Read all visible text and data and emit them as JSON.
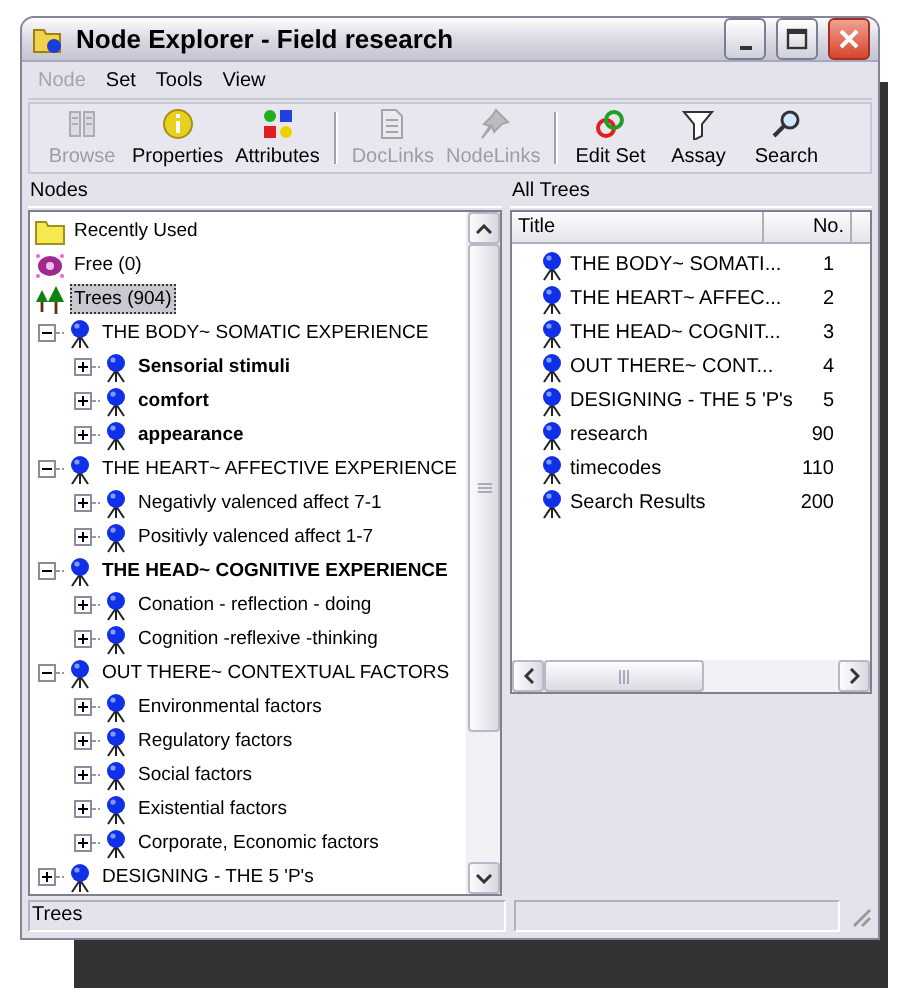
{
  "window": {
    "title": "Node Explorer - Field research"
  },
  "menu": [
    {
      "label": "Node",
      "disabled": true
    },
    {
      "label": "Set",
      "disabled": false
    },
    {
      "label": "Tools",
      "disabled": false
    },
    {
      "label": "View",
      "disabled": false
    }
  ],
  "toolbar": [
    [
      {
        "label": "Browse",
        "disabled": true
      },
      {
        "label": "Properties",
        "disabled": false
      },
      {
        "label": "Attributes",
        "disabled": false
      }
    ],
    [
      {
        "label": "DocLinks",
        "disabled": true
      },
      {
        "label": "NodeLinks",
        "disabled": true
      }
    ],
    [
      {
        "label": "Edit Set",
        "disabled": false
      },
      {
        "label": "Assay",
        "disabled": false
      },
      {
        "label": "Search",
        "disabled": false
      }
    ]
  ],
  "nodes_pane": {
    "title": "Nodes",
    "items": [
      {
        "kind": "folder",
        "label": "Recently Used",
        "selected": false
      },
      {
        "kind": "pool",
        "label": "Free (0)",
        "selected": false
      },
      {
        "kind": "trees",
        "label": "Trees (904)",
        "selected": true,
        "children": [
          {
            "label": "THE BODY~ SOMATIC EXPERIENCE",
            "bold": false,
            "expanded": true,
            "selected": false,
            "children": [
              {
                "label": "Sensorial stimuli",
                "bold": true,
                "expanded": false,
                "selected": false
              },
              {
                "label": "comfort",
                "bold": true,
                "expanded": false,
                "selected": false
              },
              {
                "label": "appearance",
                "bold": true,
                "expanded": false,
                "selected": false
              }
            ]
          },
          {
            "label": "THE HEART~ AFFECTIVE EXPERIENCE",
            "bold": false,
            "expanded": true,
            "selected": false,
            "children": [
              {
                "label": "Negativly valenced affect 7-1",
                "bold": false,
                "expanded": false,
                "selected": false
              },
              {
                "label": "Positivly valenced affect 1-7",
                "bold": false,
                "expanded": false,
                "selected": false
              }
            ]
          },
          {
            "label": "THE HEAD~ COGNITIVE EXPERIENCE",
            "bold": true,
            "expanded": true,
            "selected": false,
            "children": [
              {
                "label": "Conation - reflection - doing",
                "bold": false,
                "expanded": false,
                "selected": false
              },
              {
                "label": "Cognition -reflexive -thinking",
                "bold": false,
                "expanded": false,
                "selected": false
              }
            ]
          },
          {
            "label": "OUT THERE~ CONTEXTUAL FACTORS",
            "bold": false,
            "expanded": true,
            "selected": false,
            "children": [
              {
                "label": "Environmental factors",
                "bold": false,
                "expanded": false,
                "selected": false
              },
              {
                "label": "Regulatory factors",
                "bold": false,
                "expanded": false,
                "selected": false
              },
              {
                "label": "Social factors",
                "bold": false,
                "expanded": false,
                "selected": false
              },
              {
                "label": "Existential factors",
                "bold": false,
                "expanded": false,
                "selected": false
              },
              {
                "label": "Corporate, Economic factors",
                "bold": false,
                "expanded": false,
                "selected": false
              }
            ]
          },
          {
            "label": "DESIGNING - THE 5 'P's",
            "bold": false,
            "expanded": false,
            "selected": false
          }
        ]
      }
    ]
  },
  "trees_pane": {
    "title": "All Trees",
    "columns": [
      "Title",
      "No."
    ],
    "rows": [
      {
        "title": "THE BODY~ SOMATI...",
        "number": "1"
      },
      {
        "title": "THE HEART~ AFFEC...",
        "number": "2"
      },
      {
        "title": "THE HEAD~ COGNIT...",
        "number": "3"
      },
      {
        "title": "OUT THERE~ CONT...",
        "number": "4"
      },
      {
        "title": "DESIGNING - THE 5 'P's",
        "number": "5"
      },
      {
        "title": "research",
        "number": "90"
      },
      {
        "title": "timecodes",
        "number": "110"
      },
      {
        "title": "Search Results",
        "number": "200"
      }
    ]
  },
  "status_bar": {
    "text": "Trees"
  }
}
